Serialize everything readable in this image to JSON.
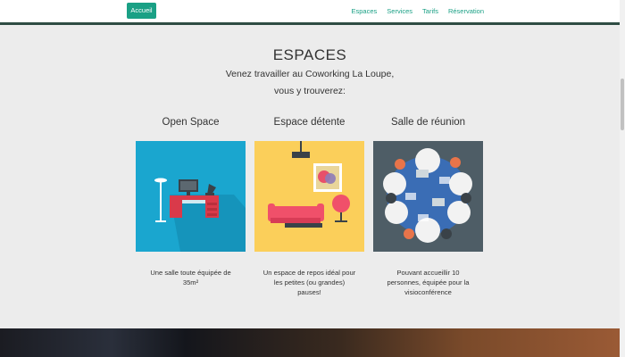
{
  "nav": {
    "brand": "Accueil",
    "links": [
      "Espaces",
      "Services",
      "Tarifs",
      "Réservation"
    ]
  },
  "section": {
    "title": "ESPACES",
    "subtitle_line1": "Venez travailler au Coworking La Loupe,",
    "subtitle_line2": "vous y trouverez:"
  },
  "cards": [
    {
      "title": "Open Space",
      "desc_lines": [
        "Une salle toute équipée de",
        "35m²"
      ],
      "bg": "#1aa6cf"
    },
    {
      "title": "Espace détente",
      "desc_lines": [
        "Un espace de repos idéal pour",
        "les petites (ou grandes)",
        "pauses!"
      ],
      "bg": "#fbcf5a"
    },
    {
      "title": "Salle de réunion",
      "desc_lines": [
        "Pouvant accueillir 10",
        "personnes, équipée pour la",
        "visioconférence"
      ],
      "bg": "#4e5d66"
    }
  ],
  "colors": {
    "accent": "#1aa085",
    "nav_border": "#2e4c43",
    "page_bg": "#ececec"
  }
}
